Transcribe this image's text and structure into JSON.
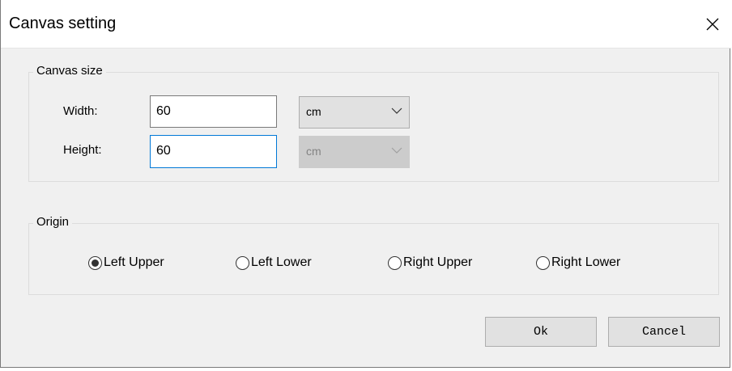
{
  "window": {
    "title": "Canvas setting",
    "close_icon": "close-icon"
  },
  "canvas_size": {
    "legend": "Canvas size",
    "width_label": "Width:",
    "width_value": "60",
    "width_unit": "cm",
    "height_label": "Height:",
    "height_value": "60",
    "height_unit": "cm",
    "height_unit_disabled": true
  },
  "origin": {
    "legend": "Origin",
    "options": [
      {
        "label": "Left Upper",
        "selected": true
      },
      {
        "label": "Left Lower",
        "selected": false
      },
      {
        "label": "Right Upper",
        "selected": false
      },
      {
        "label": "Right Lower",
        "selected": false
      }
    ]
  },
  "buttons": {
    "ok_label": "Ok",
    "cancel_label": "Cancel"
  },
  "colors": {
    "focus_border": "#0078d7",
    "dialog_bg": "#f0f0f0",
    "button_bg": "#e1e1e1"
  }
}
